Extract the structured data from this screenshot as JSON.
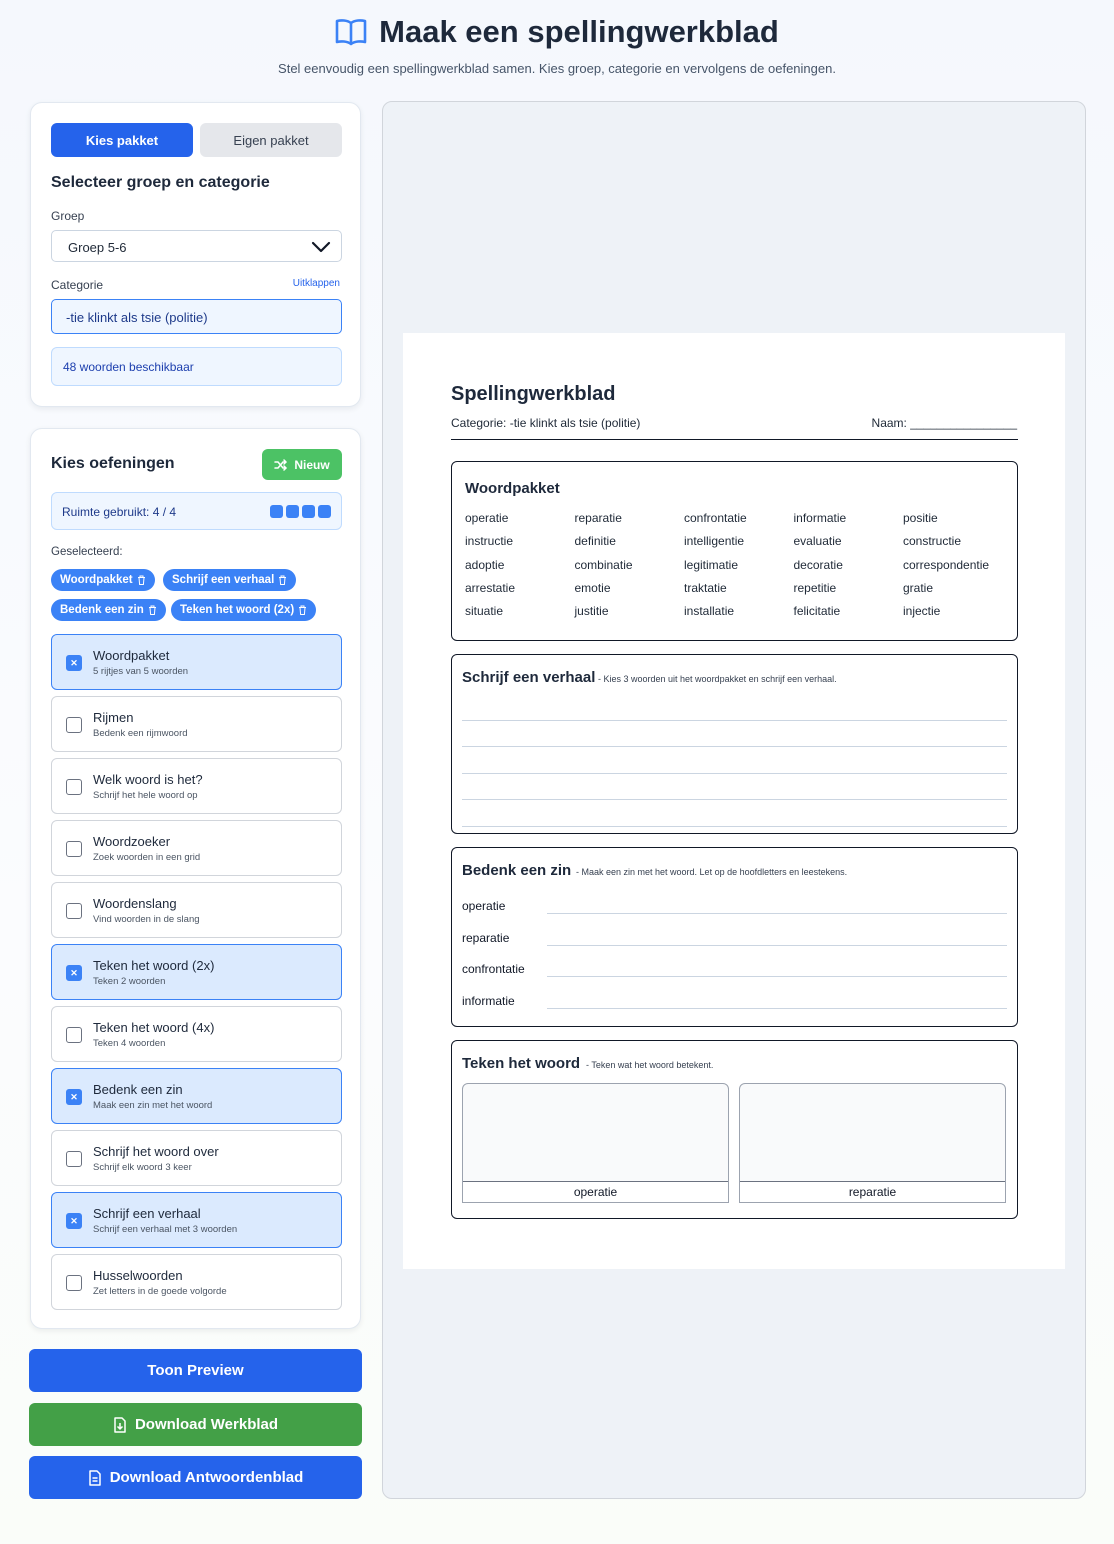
{
  "header": {
    "title": "Maak een spellingwerkblad",
    "subtitle": "Stel eenvoudig een spellingwerkblad samen. Kies groep, categorie en vervolgens de oefeningen."
  },
  "package_card": {
    "tabs": [
      "Kies pakket",
      "Eigen pakket"
    ],
    "active_tab": "Kies pakket",
    "heading": "Selecteer groep en categorie",
    "group_label": "Groep",
    "group_value": "Groep 5-6",
    "category_label": "Categorie",
    "expand_link": "Uitklappen",
    "category_value": "-tie klinkt als tsie (politie)",
    "available_text": "48 woorden beschikbaar"
  },
  "exercise_card": {
    "heading": "Kies oefeningen",
    "new_button": "Nieuw",
    "space_text": "Ruimte gebruikt: 4 / 4",
    "space_used": 4,
    "space_total": 4,
    "selected_label": "Geselecteerd:",
    "selected_chips": [
      "Woordpakket",
      "Schrijf een verhaal",
      "Bedenk een zin",
      "Teken het woord (2x)"
    ],
    "exercises": [
      {
        "title": "Woordpakket",
        "sub": "5 rijtjes van 5 woorden",
        "checked": true
      },
      {
        "title": "Rijmen",
        "sub": "Bedenk een rijmwoord",
        "checked": false
      },
      {
        "title": "Welk woord is het?",
        "sub": "Schrijf het hele woord op",
        "checked": false
      },
      {
        "title": "Woordzoeker",
        "sub": "Zoek woorden in een grid",
        "checked": false
      },
      {
        "title": "Woordenslang",
        "sub": "Vind woorden in de slang",
        "checked": false
      },
      {
        "title": "Teken het woord (2x)",
        "sub": "Teken 2 woorden",
        "checked": true
      },
      {
        "title": "Teken het woord (4x)",
        "sub": "Teken 4 woorden",
        "checked": false
      },
      {
        "title": "Bedenk een zin",
        "sub": "Maak een zin met het woord",
        "checked": true
      },
      {
        "title": "Schrijf het woord over",
        "sub": "Schrijf elk woord 3 keer",
        "checked": false
      },
      {
        "title": "Schrijf een verhaal",
        "sub": "Schrijf een verhaal met 3 woorden",
        "checked": true
      },
      {
        "title": "Husselwoorden",
        "sub": "Zet letters in de goede volgorde",
        "checked": false
      }
    ]
  },
  "actions": {
    "preview": "Toon Preview",
    "download_sheet": "Download Werkblad",
    "download_answers": "Download Antwoordenblad"
  },
  "colors": {
    "primary": "#2563eb",
    "success": "#43a047",
    "chip": "#3b82f6",
    "new_button": "#4cc265"
  },
  "worksheet": {
    "title": "Spellingwerkblad",
    "category_line": "Categorie: -tie klinkt als tsie (politie)",
    "name_label": "Naam: ________________",
    "wordpack": {
      "title": "Woordpakket",
      "columns": [
        [
          "operatie",
          "instructie",
          "adoptie",
          "arrestatie",
          "situatie"
        ],
        [
          "reparatie",
          "definitie",
          "combinatie",
          "emotie",
          "justitie"
        ],
        [
          "confrontatie",
          "intelligentie",
          "legitimatie",
          "traktatie",
          "installatie"
        ],
        [
          "informatie",
          "evaluatie",
          "decoratie",
          "repetitie",
          "felicitatie"
        ],
        [
          "positie",
          "constructie",
          "correspondentie",
          "gratie",
          "injectie"
        ]
      ]
    },
    "story": {
      "title": "Schrijf een verhaal",
      "instruction": "- Kies 3 woorden uit het woordpakket en schrijf een verhaal."
    },
    "sentence": {
      "title": "Bedenk een zin",
      "instruction": "- Maak een zin met het woord. Let op de hoofdletters en leestekens.",
      "words": [
        "operatie",
        "reparatie",
        "confrontatie",
        "informatie"
      ]
    },
    "draw": {
      "title": "Teken het woord",
      "instruction": "- Teken wat het woord betekent.",
      "words": [
        "operatie",
        "reparatie"
      ]
    }
  }
}
